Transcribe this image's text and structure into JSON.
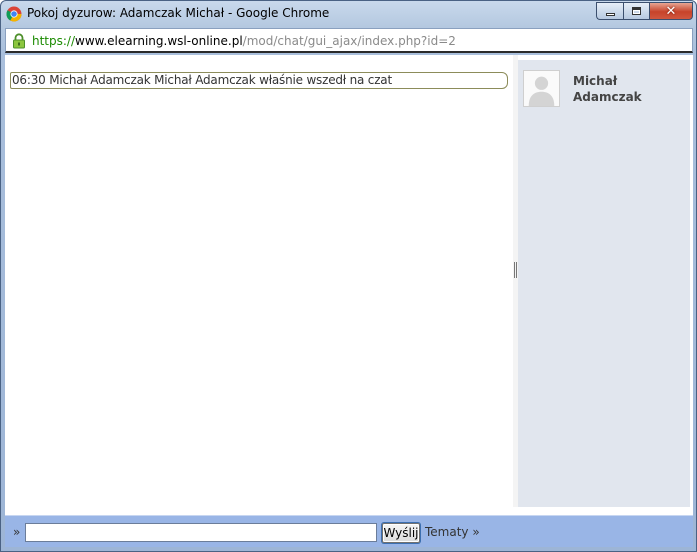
{
  "window": {
    "title": "Pokoj dyzurow: Adamczak Michał - Google Chrome",
    "close_glyph": "✕"
  },
  "address_bar": {
    "scheme": "https://",
    "host": "www.elearning.wsl-online.pl",
    "path": "/mod/chat/gui_ajax/index.php?id=2"
  },
  "chat": {
    "messages": [
      {
        "text": "06:30 Michał Adamczak Michał Adamczak właśnie wszedł na czat"
      }
    ]
  },
  "users": [
    {
      "name": "Michał Adamczak"
    }
  ],
  "input_bar": {
    "prompt": "»",
    "message_value": "",
    "send_label": "Wyślij",
    "topics_label": "Tematy »"
  },
  "colors": {
    "input_bar_bg": "#99b5e6",
    "users_panel_bg": "#e1e6ee",
    "url_scheme_green": "#1a8a00"
  }
}
